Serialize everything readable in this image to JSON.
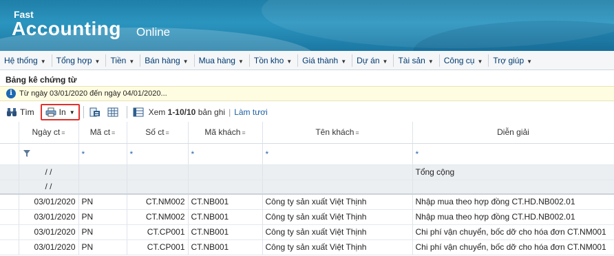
{
  "header": {
    "logo_small": "Fast",
    "logo_big": "Accounting",
    "logo_suffix": "Online"
  },
  "menu": [
    {
      "label": "Hệ thống"
    },
    {
      "label": "Tổng hợp"
    },
    {
      "label": "Tiền"
    },
    {
      "label": "Bán hàng"
    },
    {
      "label": "Mua hàng"
    },
    {
      "label": "Tồn kho"
    },
    {
      "label": "Giá thành"
    },
    {
      "label": "Dự án"
    },
    {
      "label": "Tài sản"
    },
    {
      "label": "Công cụ"
    },
    {
      "label": "Trợ giúp"
    }
  ],
  "page": {
    "title": "Bảng kê chứng từ",
    "info": "Từ ngày 03/01/2020 đến ngày 04/01/2020..."
  },
  "toolbar": {
    "search_label": "Tìm",
    "print_label": "In",
    "view_prefix": "Xem",
    "view_range": "1-10/10",
    "view_suffix": "bản ghi",
    "refresh_label": "Làm tươi"
  },
  "grid": {
    "columns": [
      "Ngày ct",
      "Mã ct",
      "Số ct",
      "Mã khách",
      "Tên khách",
      "Diễn giải"
    ],
    "filter_marker": "*",
    "total_rows": [
      {
        "date": "/ /",
        "desc": "Tổng cộng"
      },
      {
        "date": "/ /",
        "desc": ""
      }
    ],
    "rows": [
      {
        "date": "03/01/2020",
        "type": "PN",
        "number": "CT.NM002",
        "customer_code": "CT.NB001",
        "customer_name": "Công ty sản xuất Việt Thịnh",
        "desc": "Nhập mua theo hợp đồng CT.HD.NB002.01"
      },
      {
        "date": "03/01/2020",
        "type": "PN",
        "number": "CT.NM002",
        "customer_code": "CT.NB001",
        "customer_name": "Công ty sản xuất Việt Thịnh",
        "desc": "Nhập mua theo hợp đồng CT.HD.NB002.01"
      },
      {
        "date": "03/01/2020",
        "type": "PN",
        "number": "CT.CP001",
        "customer_code": "CT.NB001",
        "customer_name": "Công ty sản xuất Việt Thịnh",
        "desc": "Chi phí vận chuyển, bốc dỡ cho hóa đơn CT.NM001"
      },
      {
        "date": "03/01/2020",
        "type": "PN",
        "number": "CT.CP001",
        "customer_code": "CT.NB001",
        "customer_name": "Công ty sản xuất Việt Thịnh",
        "desc": "Chi phí vận chuyển, bốc dỡ cho hóa đơn CT.NM001"
      }
    ]
  }
}
